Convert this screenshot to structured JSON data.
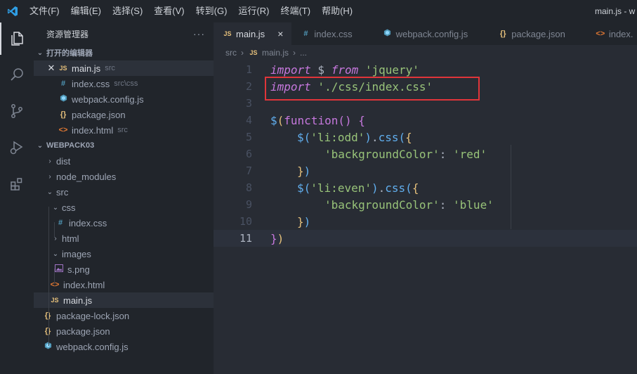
{
  "menu": [
    "文件(F)",
    "编辑(E)",
    "选择(S)",
    "查看(V)",
    "转到(G)",
    "运行(R)",
    "终端(T)",
    "帮助(H)"
  ],
  "window_title": "main.js - w",
  "activity": [
    "files-icon",
    "search-icon",
    "source-control-icon",
    "run-debug-icon",
    "extensions-icon"
  ],
  "sidebar": {
    "header": "资源管理器",
    "more": "···",
    "open_editors_title": "打开的编辑器",
    "open_editors": [
      {
        "icon": "JS",
        "name": "main.js",
        "path": "src"
      },
      {
        "icon": "#",
        "name": "index.css",
        "path": "src\\css"
      },
      {
        "icon": "webpack",
        "name": "webpack.config.js",
        "path": ""
      },
      {
        "icon": "{}",
        "name": "package.json",
        "path": ""
      },
      {
        "icon": "<>",
        "name": "index.html",
        "path": "src"
      }
    ],
    "project_title": "WEBPACK03",
    "tree": {
      "dist": "dist",
      "node_modules": "node_modules",
      "src": "src",
      "css": "css",
      "index_css": "index.css",
      "html": "html",
      "images": "images",
      "s_png": "s.png",
      "index_html": "index.html",
      "main_js": "main.js",
      "package_lock": "package-lock.json",
      "package_json": "package.json",
      "webpack_config": "webpack.config.js"
    }
  },
  "tabs": [
    {
      "icon": "JS",
      "label": "main.js",
      "close": "×"
    },
    {
      "icon": "#",
      "label": "index.css"
    },
    {
      "icon": "webpack",
      "label": "webpack.config.js"
    },
    {
      "icon": "{}",
      "label": "package.json"
    },
    {
      "icon": "<>",
      "label": "index."
    }
  ],
  "breadcrumb": {
    "folder": "src",
    "file_icon": "JS",
    "file": "main.js",
    "more": "..."
  },
  "editor": {
    "line_numbers": [
      "1",
      "2",
      "3",
      "4",
      "5",
      "6",
      "7",
      "8",
      "9",
      "10",
      "11"
    ],
    "code": {
      "l1_import": "import",
      "l1_dollar": " $ ",
      "l1_from": "from",
      "l1_str": " 'jquery'",
      "l2_import": "import",
      "l2_str": " './css/index.css'",
      "l4_dollar": "$",
      "l4_open": "(",
      "l4_function": "function",
      "l4_parens": "() ",
      "l4_brace": "{",
      "l5_dollar": "$",
      "l5_open": "(",
      "l5_str": "'li:odd'",
      "l5_close": ")",
      "l5_dot": ".",
      "l5_css": "css",
      "l5_paren": "(",
      "l5_brace": "{",
      "l6_key": "'backgroundColor'",
      "l6_colon": ": ",
      "l6_val": "'red'",
      "l7_brace": "}",
      "l7_paren": ")",
      "l8_dollar": "$",
      "l8_open": "(",
      "l8_str": "'li:even'",
      "l8_close": ")",
      "l8_dot": ".",
      "l8_css": "css",
      "l8_paren": "(",
      "l8_brace": "{",
      "l9_key": "'backgroundColor'",
      "l9_colon": ": ",
      "l9_val": "'blue'",
      "l10_brace": "}",
      "l10_paren": ")",
      "l11_brace": "}",
      "l11_paren": ")"
    }
  },
  "colors": {
    "highlight_box": "#e0353a",
    "accent": "#61afef"
  }
}
